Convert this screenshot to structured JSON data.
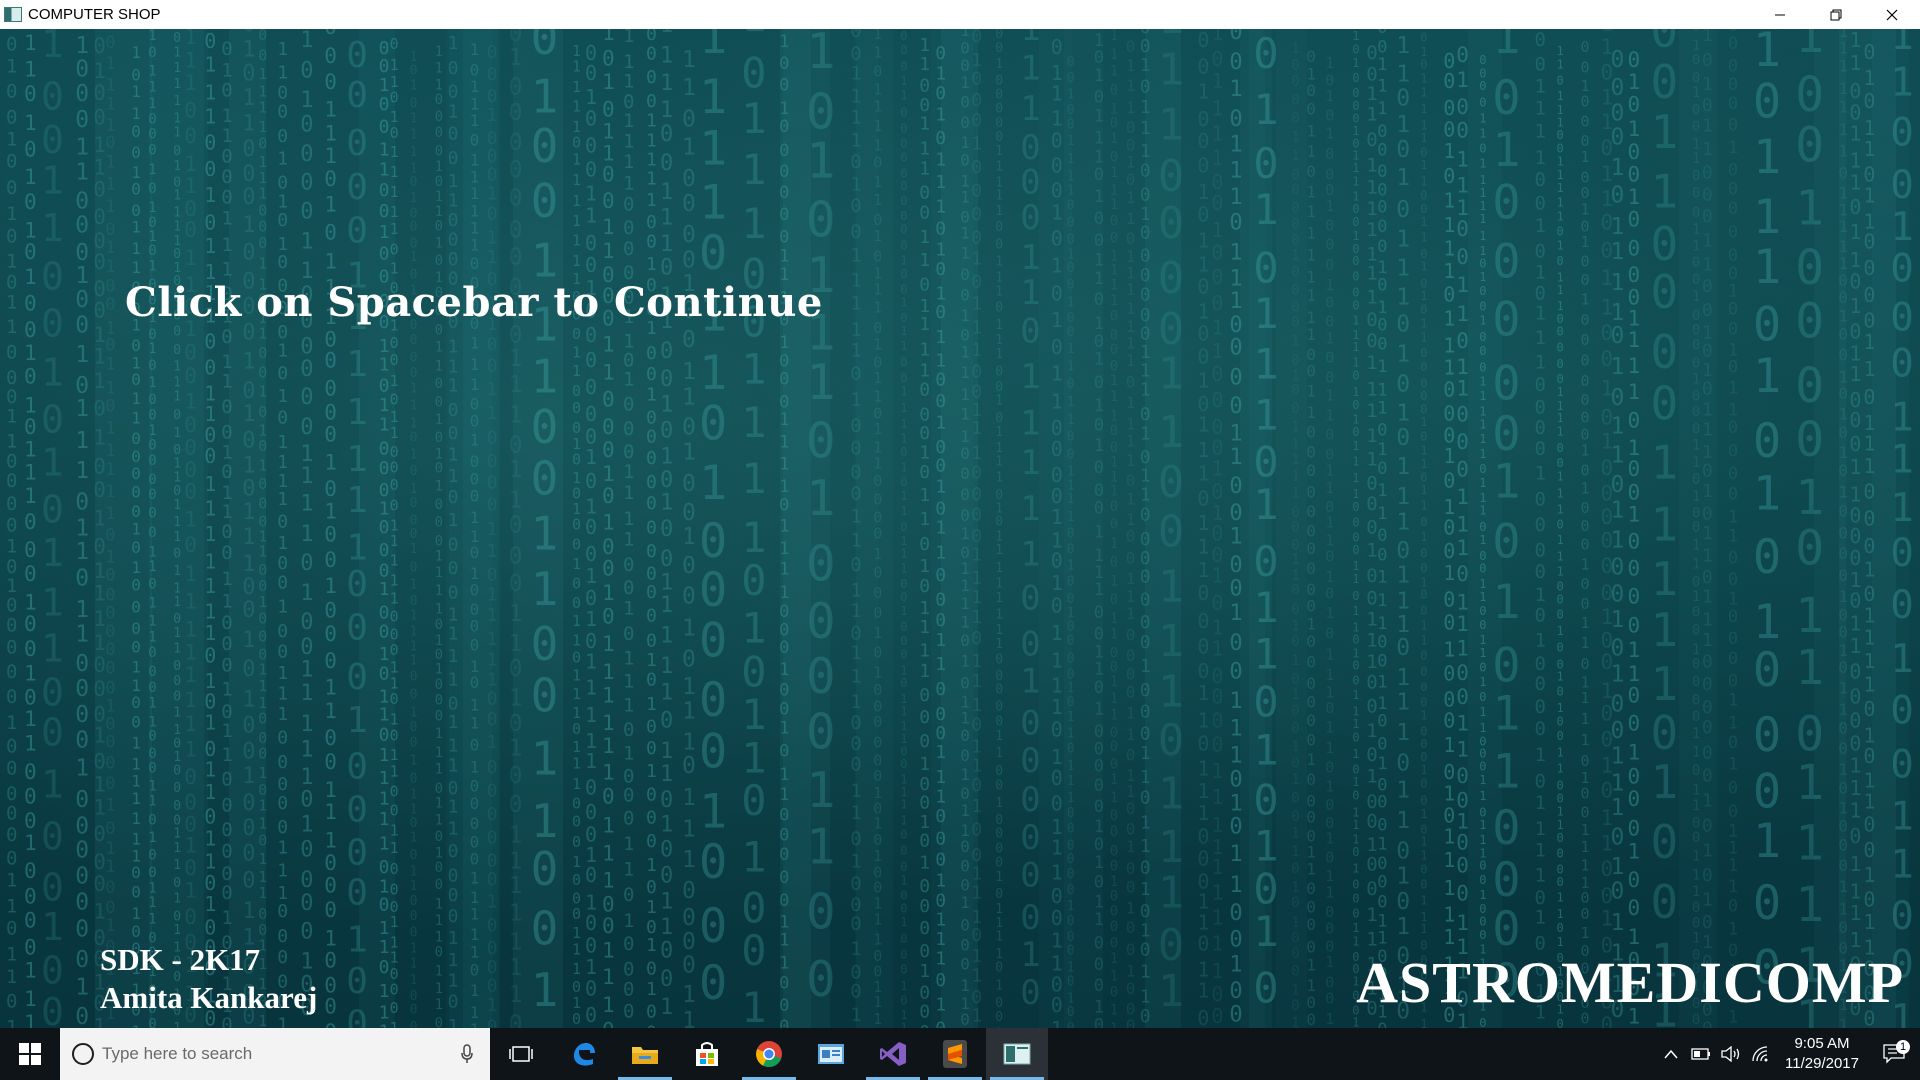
{
  "window": {
    "title": "COMPUTER SHOP",
    "controls": [
      "minimize-icon",
      "restore-icon",
      "close-icon"
    ]
  },
  "main": {
    "continue_prompt": "Click on Spacebar to Continue",
    "credit_line1": "SDK - 2K17",
    "credit_line2": "Amita Kankarej",
    "brand": "ASTROMEDICOMP",
    "background_digits": [
      "0",
      "1"
    ]
  },
  "taskbar": {
    "search_placeholder": "Type here to search",
    "apps": [
      {
        "name": "task-view-icon",
        "state": "normal"
      },
      {
        "name": "edge-icon",
        "state": "normal"
      },
      {
        "name": "file-explorer-icon",
        "state": "open"
      },
      {
        "name": "store-icon",
        "state": "normal"
      },
      {
        "name": "chrome-icon",
        "state": "open"
      },
      {
        "name": "control-panel-icon",
        "state": "normal"
      },
      {
        "name": "visual-studio-icon",
        "state": "open"
      },
      {
        "name": "sublime-text-icon",
        "state": "open"
      },
      {
        "name": "computer-shop-app-icon",
        "state": "active"
      }
    ],
    "time": "9:05 AM",
    "date": "11/29/2017",
    "notification_count": "1"
  },
  "colors": {
    "background_teal": "#0e4a52",
    "digit_teal": "#3fa6a6",
    "taskbar": "#0f1418",
    "accent_blue": "#76b9ed"
  }
}
